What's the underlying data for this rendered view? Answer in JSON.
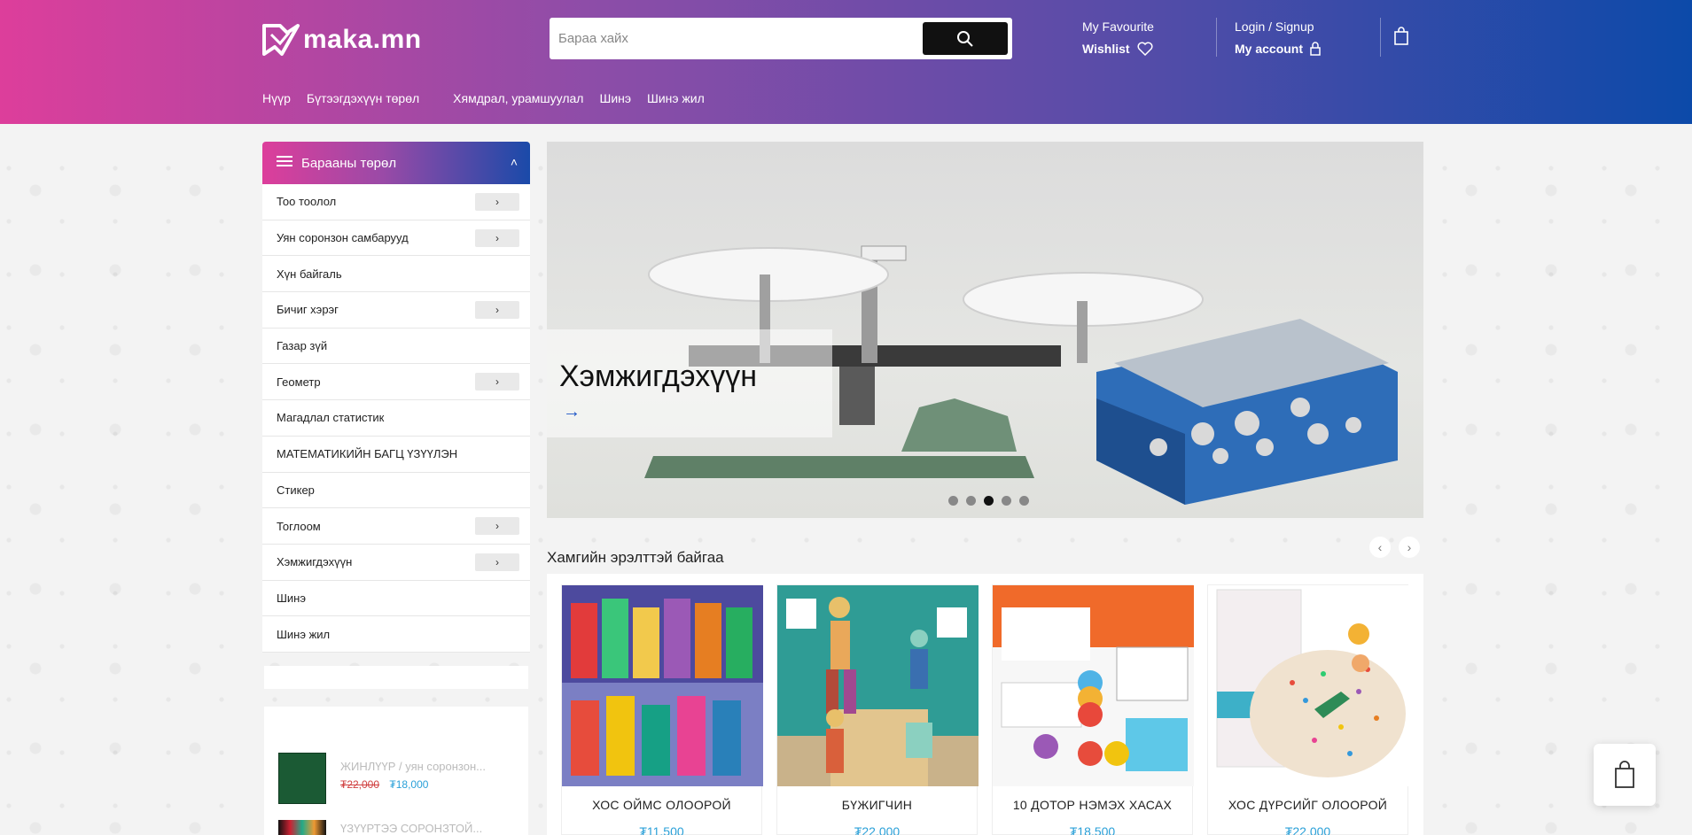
{
  "header": {
    "logo_text": "maka.mn",
    "search_placeholder": "Бараа хайх",
    "favourite_label": "My Favourite",
    "wishlist_label": "Wishlist",
    "login_label": "Login / Signup",
    "account_label": "My account"
  },
  "nav": [
    "Нүүр",
    "Бүтээгдэхүүн төрөл",
    "Хямдрал, урамшуулал",
    "Шинэ",
    "Шинэ жил"
  ],
  "sidebar": {
    "title": "Барааны төрөл",
    "items": [
      {
        "label": "Тоо тоолол",
        "has_sub": true
      },
      {
        "label": "Уян соронзон самбарууд",
        "has_sub": true
      },
      {
        "label": "Хүн байгаль",
        "has_sub": false
      },
      {
        "label": "Бичиг хэрэг",
        "has_sub": true
      },
      {
        "label": "Газар зүй",
        "has_sub": false
      },
      {
        "label": "Геометр",
        "has_sub": true
      },
      {
        "label": "Магадлал статистик",
        "has_sub": false
      },
      {
        "label": "МАТЕМАТИКИЙН БАГЦ ҮЗҮҮЛЭН",
        "has_sub": false
      },
      {
        "label": "Стикер",
        "has_sub": false
      },
      {
        "label": "Тоглоом",
        "has_sub": true
      },
      {
        "label": "Хэмжигдэхүүн",
        "has_sub": true
      },
      {
        "label": "Шинэ",
        "has_sub": false
      },
      {
        "label": "Шинэ жил",
        "has_sub": false
      }
    ],
    "mini_products": [
      {
        "name": "ЖИНЛҮҮР / уян соронзон...",
        "old_price": "₮22,000",
        "new_price": "₮18,000"
      },
      {
        "name": "ҮЗҮҮРТЭЭ СОРОНЗТОЙ...",
        "old_price": "",
        "new_price": ""
      }
    ]
  },
  "slider": {
    "caption": "Хэмжигдэхүүн",
    "arrow": "→",
    "slide_count": 5,
    "active_slide": 3
  },
  "products": {
    "section_title": "Хамгийн эрэлттэй байгаа",
    "prev": "‹",
    "next": "›",
    "items": [
      {
        "name": "ХОС ОЙМС ОЛООРОЙ",
        "price": "₮11,500"
      },
      {
        "name": "БҮЖИГЧИН",
        "price": "₮22,000"
      },
      {
        "name": "10 ДОТОР НЭМЭХ ХАСАХ",
        "price": "₮18,500"
      },
      {
        "name": "ХОС ДҮРСИЙГ ОЛООРОЙ",
        "price": "₮22,000"
      }
    ]
  }
}
